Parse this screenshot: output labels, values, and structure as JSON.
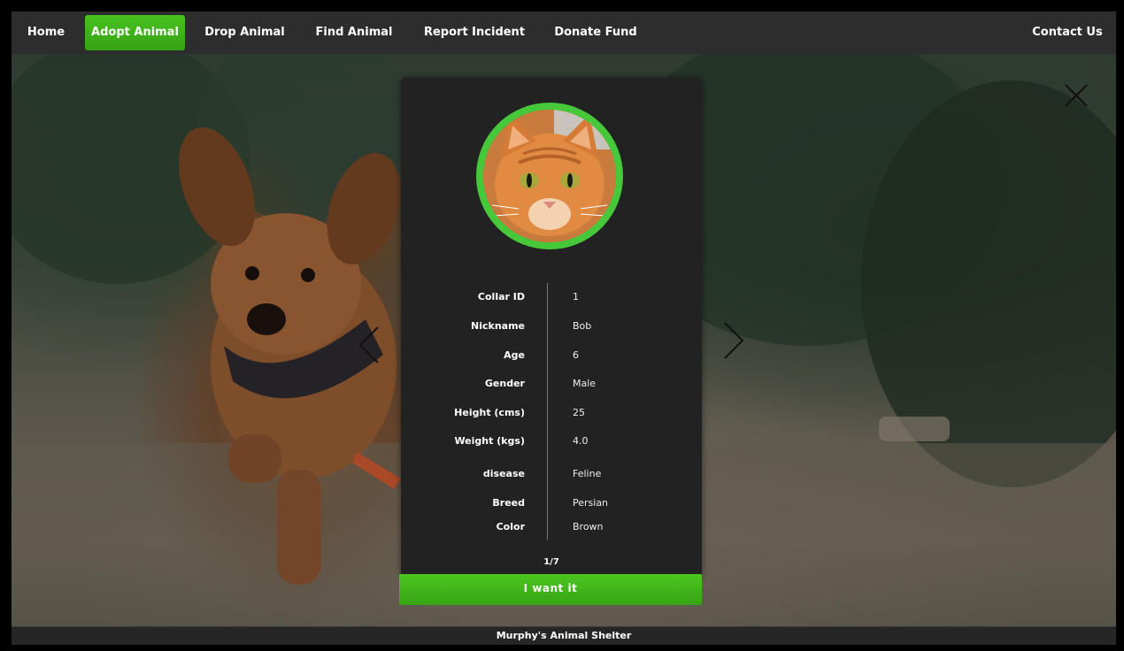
{
  "nav": {
    "items": [
      {
        "label": "Home"
      },
      {
        "label": "Adopt Animal"
      },
      {
        "label": "Drop Animal"
      },
      {
        "label": "Find Animal"
      },
      {
        "label": "Report Incident"
      },
      {
        "label": "Donate Fund"
      }
    ],
    "contact": "Contact Us",
    "active_index": 1
  },
  "colors": {
    "accent": "#41b81c",
    "avatar_ring": "#46c83a",
    "navbar": "#2d2d2d",
    "card": "#222222"
  },
  "card": {
    "fields": [
      {
        "label": "Collar ID",
        "value": "1"
      },
      {
        "label": "Nickname",
        "value": "Bob"
      },
      {
        "label": "Age",
        "value": "6"
      },
      {
        "label": "Gender",
        "value": "Male"
      },
      {
        "label": "Height (cms)",
        "value": "25"
      },
      {
        "label": "Weight (kgs)",
        "value": "4.0"
      },
      {
        "label": "disease",
        "value": "Feline"
      },
      {
        "label": "Breed",
        "value": "Persian"
      },
      {
        "label": "Color",
        "value": "Brown"
      }
    ],
    "pager": "1/7",
    "action_label": "I want it"
  },
  "icons": {
    "close": "close-icon",
    "prev": "chevron-left-icon",
    "next": "chevron-right-icon"
  },
  "footer": {
    "text": "Murphy's Animal Shelter"
  }
}
